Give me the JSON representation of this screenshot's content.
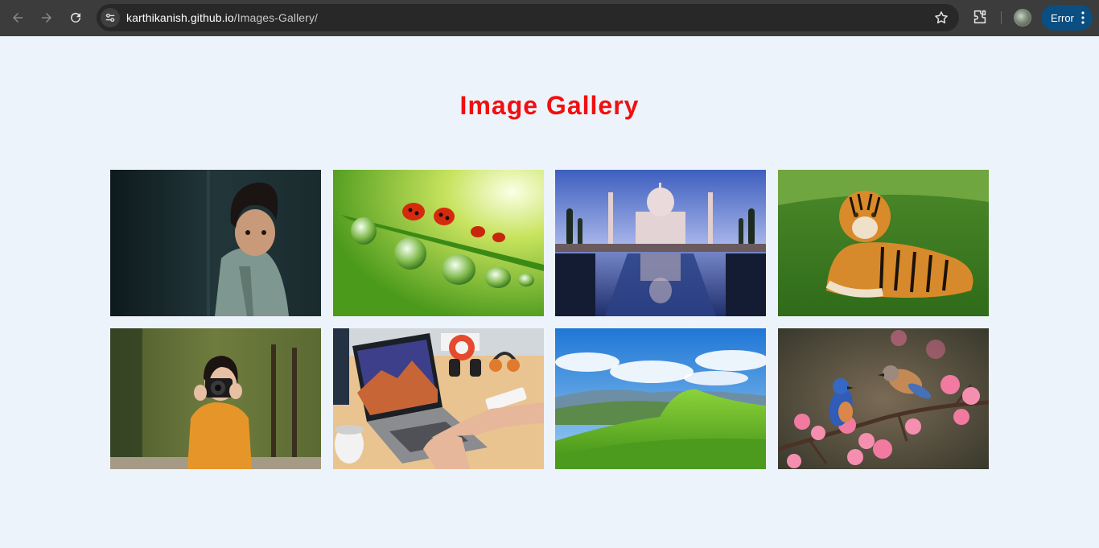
{
  "browser": {
    "url_host": "karthikanish.github.io",
    "url_path": "/Images-Gallery/",
    "error_chip_label": "Error",
    "icons": [
      "back-arrow-icon",
      "forward-arrow-icon",
      "reload-icon",
      "site-info-icon",
      "star-icon",
      "extensions-icon",
      "profile-avatar",
      "kebab-menu-icon"
    ]
  },
  "page": {
    "title": "Image Gallery",
    "title_color": "#f01010",
    "background": "#edf3fb"
  },
  "gallery": {
    "images": [
      {
        "subject": "child with curly hair"
      },
      {
        "subject": "ladybugs on grass blade with water drops"
      },
      {
        "subject": "Taj Mahal with reflecting pool"
      },
      {
        "subject": "tiger lying on grass"
      },
      {
        "subject": "woman holding a camera"
      },
      {
        "subject": "hands on laptop at desk"
      },
      {
        "subject": "green hills under blue sky"
      },
      {
        "subject": "two bluebirds on blossoming branch"
      }
    ]
  }
}
